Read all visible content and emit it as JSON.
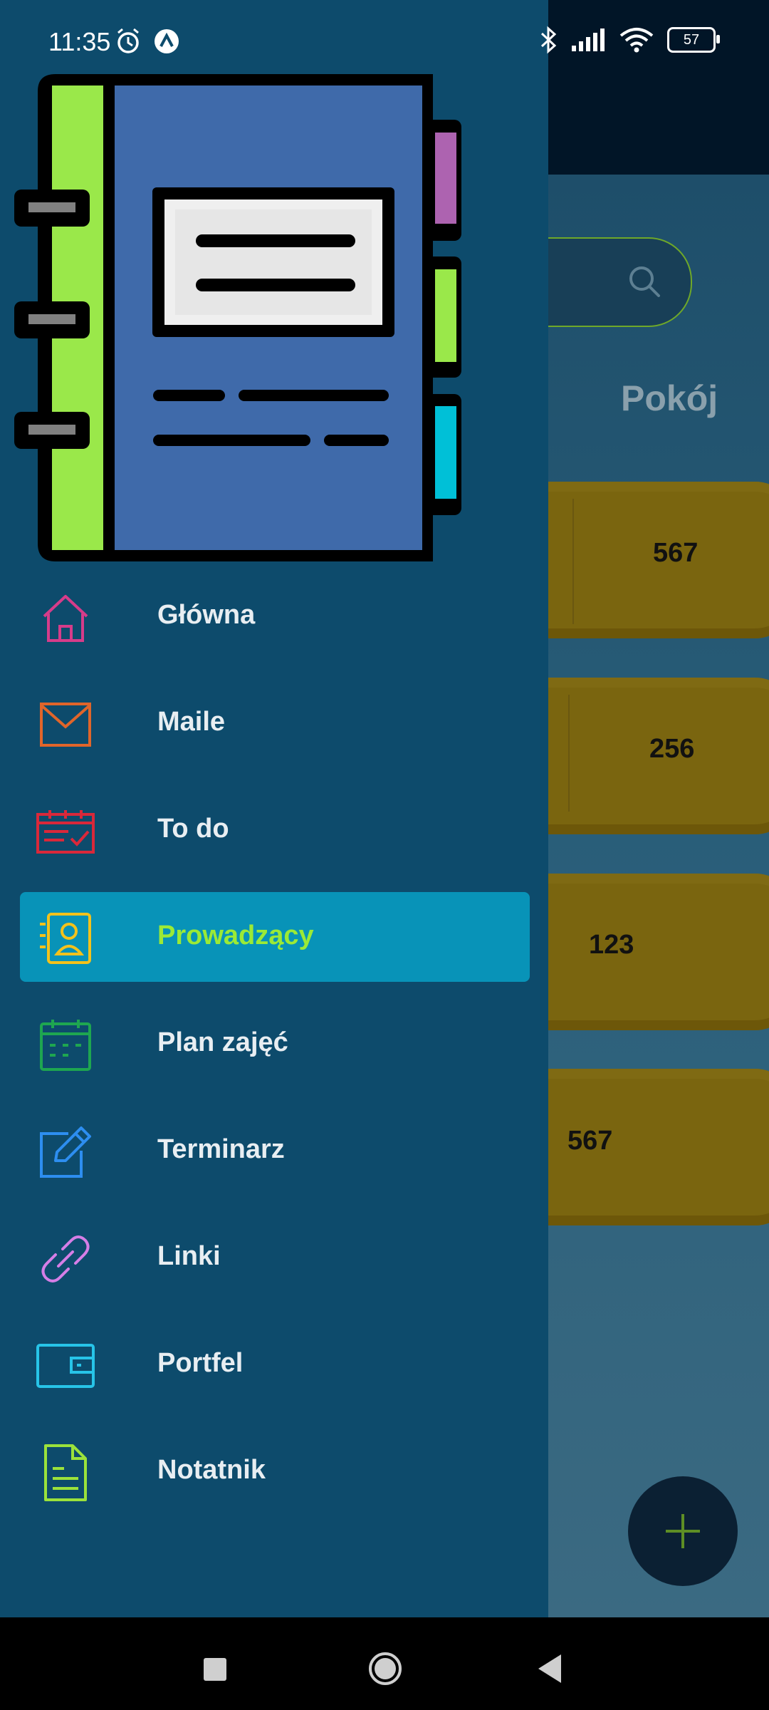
{
  "status_bar": {
    "time": "11:35",
    "battery": "57",
    "icons": [
      "alarm-icon",
      "app-notification-icon",
      "bluetooth-icon",
      "signal-icon",
      "wifi-icon",
      "battery-icon"
    ]
  },
  "background": {
    "room_header": "Pokój",
    "cards": [
      {
        "value": "567"
      },
      {
        "value": "256"
      },
      {
        "value": "123"
      },
      {
        "value": "567"
      }
    ],
    "fab_icon": "plus-icon"
  },
  "drawer": {
    "header_icon": "notebook-illustration",
    "menu": [
      {
        "label": "Główna",
        "icon": "home-icon",
        "color": "#d63c8a",
        "active": false
      },
      {
        "label": "Maile",
        "icon": "mail-icon",
        "color": "#e0652a",
        "active": false
      },
      {
        "label": "To do",
        "icon": "calendar-check-icon",
        "color": "#d9283a",
        "active": false
      },
      {
        "label": "Prowadzący",
        "icon": "contact-card-icon",
        "color": "#f3c21b",
        "active": true
      },
      {
        "label": "Plan zajęć",
        "icon": "calendar-icon",
        "color": "#1ea650",
        "active": false
      },
      {
        "label": "Terminarz",
        "icon": "edit-icon",
        "color": "#2d8ef0",
        "active": false
      },
      {
        "label": "Linki",
        "icon": "link-icon",
        "color": "#d57ee6",
        "active": false
      },
      {
        "label": "Portfel",
        "icon": "wallet-icon",
        "color": "#27c4e8",
        "active": false
      },
      {
        "label": "Notatnik",
        "icon": "document-icon",
        "color": "#9be23b",
        "active": false
      }
    ]
  },
  "colors": {
    "drawer_bg": "#0d4b6c",
    "active_item_bg": "#0893b8",
    "active_label": "#9bea36",
    "card_bg": "#7a650f"
  }
}
